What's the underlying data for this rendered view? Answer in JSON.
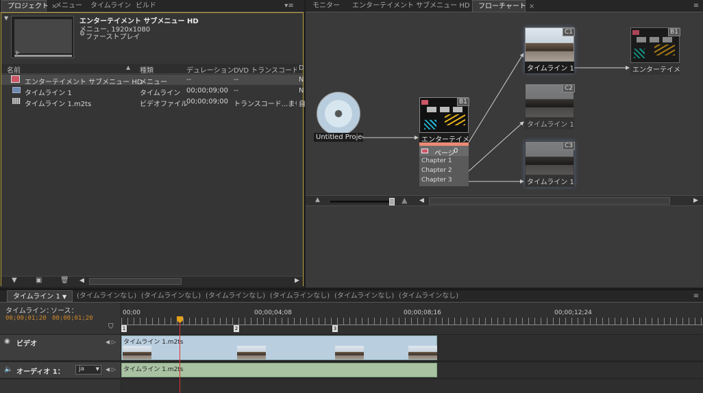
{
  "project_panel": {
    "tabs": [
      {
        "label": "プロジェクト",
        "active": true
      },
      {
        "label": "メニュー",
        "active": false
      },
      {
        "label": "タイムライン",
        "active": false
      },
      {
        "label": "ビルド",
        "active": false
      }
    ],
    "preview": {
      "title": "エンターテイメント サブメニュー HD",
      "line1": "メニュー, 1920x1080",
      "line2": "ファーストプレイ"
    },
    "columns": [
      "名前",
      "種類",
      "デュレーション",
      "DVD トランスコードス...",
      "D"
    ],
    "rows": [
      {
        "icon": "menu-icon",
        "name": "エンターテイメント サブメニュー HD",
        "type": "メニュー",
        "duration": "--",
        "dvd": "--",
        "d": "N",
        "selected": true
      },
      {
        "icon": "timeline-icon",
        "name": "タイムライン 1",
        "type": "タイムライン",
        "duration": "00;00;09;00",
        "dvd": "--",
        "d": "N",
        "selected": false
      },
      {
        "icon": "video-file-icon",
        "name": "タイムライン 1.m2ts",
        "type": "ビデオファイル",
        "duration": "00;00;09;00",
        "dvd": "トランスコード...ません",
        "d": "自",
        "selected": false
      }
    ]
  },
  "right_panel": {
    "tabs": [
      {
        "label": "モニター",
        "active": false
      },
      {
        "label": "エンターテイメント サブメニュー HD",
        "active": false
      },
      {
        "label": "フローチャート",
        "active": true
      }
    ],
    "flowchart": {
      "disc_label": "Untitled Projec",
      "menu_node": {
        "label": "エンターテイメン",
        "badge": "B1",
        "page_label": "ページ",
        "page_num": "0",
        "chapters": [
          "Chapter 1",
          "Chapter 2",
          "Chapter 3"
        ]
      },
      "timeline_nodes": [
        {
          "label": "タイムライン 1",
          "badge": "C1"
        },
        {
          "label": "タイムライン 1",
          "badge": "C2"
        },
        {
          "label": "タイムライン 1",
          "badge": "C3"
        }
      ],
      "target_node": {
        "label": "エンターテイメン",
        "badge": "B1"
      }
    }
  },
  "timeline_panel": {
    "tabs": [
      {
        "label": "タイムライン 1",
        "active": true
      },
      {
        "label": "(タイムラインなし)",
        "active": false
      },
      {
        "label": "(タイムラインなし)",
        "active": false
      },
      {
        "label": "(タイムラインなし)",
        "active": false
      },
      {
        "label": "(タイムラインなし)",
        "active": false
      },
      {
        "label": "(タイムラインなし)",
        "active": false
      },
      {
        "label": "(タイムラインなし)",
        "active": false
      }
    ],
    "timeline_label": "タイムライン：",
    "source_label": "ソース：",
    "timeline_tc": "00;00;01;20",
    "source_tc": "00;00;01;20",
    "ruler": [
      "00;00",
      "00;00;04;08",
      "00;00;08;16",
      "00;00;12;24"
    ],
    "markers": [
      "1",
      "2",
      "3"
    ],
    "video_track": {
      "label": "ビデオ",
      "clip": "タイムライン 1.m2ts"
    },
    "audio_track": {
      "label": "オーディオ 1：",
      "lang": "ja",
      "clip": "タイムライン 1.m2ts"
    }
  }
}
